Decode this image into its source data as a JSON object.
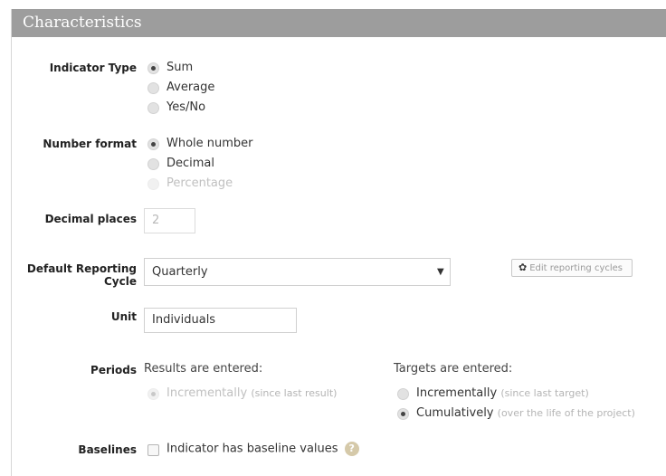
{
  "header": {
    "title": "Characteristics"
  },
  "indicator_type": {
    "label": "Indicator Type",
    "options": [
      "Sum",
      "Average",
      "Yes/No"
    ],
    "selected": "Sum"
  },
  "number_format": {
    "label": "Number format",
    "options": [
      "Whole number",
      "Decimal",
      "Percentage"
    ],
    "selected": "Whole number",
    "disabled_option": "Percentage"
  },
  "decimal_places": {
    "label": "Decimal places",
    "value": "2"
  },
  "reporting_cycle": {
    "label_line1": "Default Reporting",
    "label_line2": "Cycle",
    "value": "Quarterly",
    "edit_button": "Edit reporting cycles"
  },
  "unit": {
    "label": "Unit",
    "value": "Individuals"
  },
  "periods": {
    "label": "Periods",
    "results_heading": "Results are entered:",
    "results_option": "Incrementally",
    "results_hint": "(since last result)",
    "targets_heading": "Targets are entered:",
    "targets_incremental": "Incrementally",
    "targets_incremental_hint": "(since last target)",
    "targets_cumulative": "Cumulatively",
    "targets_cumulative_hint": "(over the life of the project)",
    "targets_selected": "Cumulatively"
  },
  "baselines": {
    "label": "Baselines",
    "checkbox_label": "Indicator has baseline values",
    "checked": false,
    "help": "?"
  },
  "icons": {
    "gear": "gear-icon",
    "dropdown": "chevron-down-icon",
    "help": "help-icon"
  }
}
